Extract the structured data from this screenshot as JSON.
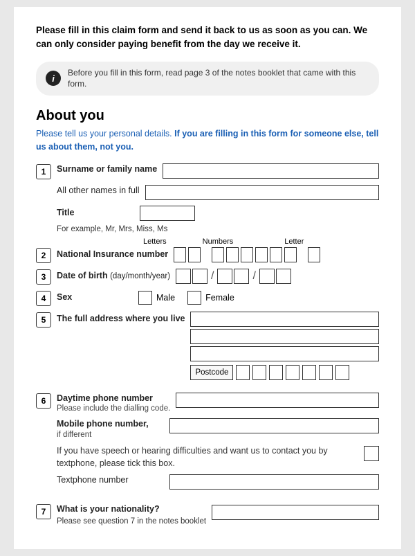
{
  "intro": {
    "text": "Please fill in this claim form and send it back to us as soon as you can. We can only consider paying benefit from the day we receive it."
  },
  "infobox": {
    "icon": "i",
    "text": "Before you fill in this form, read page 3 of the notes booklet that came with this form."
  },
  "about": {
    "title": "About you",
    "intro_normal": "Please tell us your personal details. ",
    "intro_bold": "If you are filling in this form for someone else, tell us about them, not you."
  },
  "fields": {
    "q1_label": "Surname or family name",
    "q1_number": "1",
    "all_other_names_label": "All other names in full",
    "title_label": "Title",
    "title_example": "For example, Mr, Mrs, Miss, Ms",
    "ni_label": "National Insurance number",
    "ni_number": "2",
    "ni_letters_label": "Letters",
    "ni_numbers_label": "Numbers",
    "ni_letter_label": "Letter",
    "dob_label": "Date of birth",
    "dob_sublabel": "(day/month/year)",
    "dob_number": "3",
    "sex_label": "Sex",
    "sex_number": "4",
    "sex_male": "Male",
    "sex_female": "Female",
    "address_label": "The full address where you live",
    "address_number": "5",
    "postcode_label": "Postcode",
    "phone_label": "Daytime phone number",
    "phone_sublabel": "Please include the dialling code.",
    "phone_number": "6",
    "mobile_label": "Mobile phone number,",
    "mobile_sublabel": "if different",
    "textphone_text": "If you have speech or hearing difficulties and want us to contact you by textphone, please tick this box.",
    "textphone_label": "Textphone number",
    "nationality_label": "What is your nationality?",
    "nationality_sublabel": "Please see question 7 in the notes booklet",
    "nationality_number": "7"
  }
}
